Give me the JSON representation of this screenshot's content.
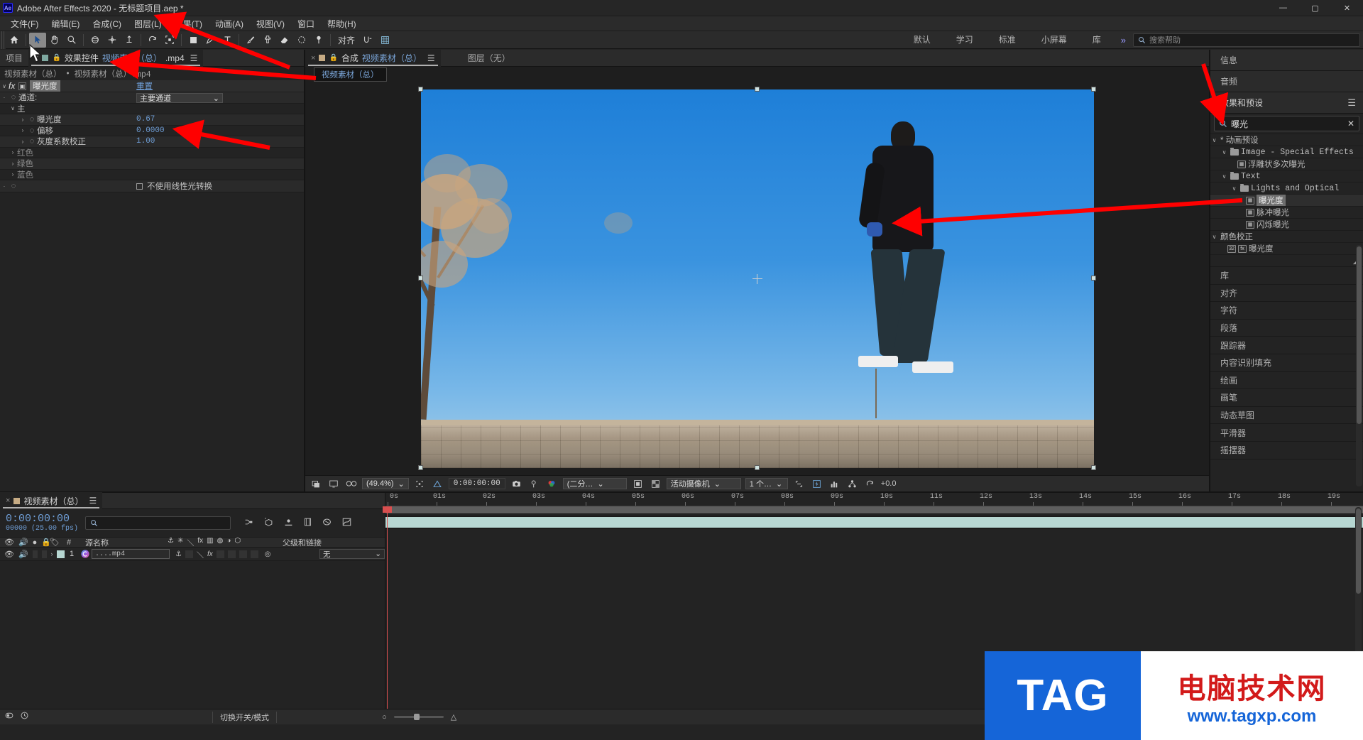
{
  "window": {
    "title": "Adobe After Effects 2020 - 无标题项目.aep *",
    "logo": "Ae",
    "minimize": "—",
    "maximize": "▢",
    "close": "✕"
  },
  "menu": {
    "items": [
      "文件(F)",
      "编辑(E)",
      "合成(C)",
      "图层(L)",
      "效果(T)",
      "动画(A)",
      "视图(V)",
      "窗口",
      "帮助(H)"
    ]
  },
  "toolbar": {
    "align_label": "对齐",
    "workspaces": [
      "默认",
      "学习",
      "标准",
      "小屏幕",
      "库"
    ],
    "more": "»",
    "help_placeholder": "搜索帮助"
  },
  "effect_controls": {
    "tab_project": "项目",
    "tab_close": "×",
    "tab_title": "效果控件",
    "tab_comp": "视频素材（总）",
    "tab_ext": ".mp4",
    "menu_icon": "☰",
    "breadcrumb_comp": "视频素材（总）",
    "breadcrumb_sep": "•",
    "breadcrumb_layer": "视频素材（总）.mp4",
    "effect_name": "曝光度",
    "reset_label": "重置",
    "fx_label": "fx",
    "rows": [
      {
        "indent": 1,
        "label": "通道:",
        "type": "dropdown",
        "value": "主要通道"
      },
      {
        "indent": 1,
        "label": "主",
        "type": "group"
      },
      {
        "indent": 2,
        "label": "曝光度",
        "type": "value",
        "value": "0.67"
      },
      {
        "indent": 2,
        "label": "偏移",
        "type": "value",
        "value": "0.0000"
      },
      {
        "indent": 2,
        "label": "灰度系数校正",
        "type": "value",
        "value": "1.00"
      },
      {
        "indent": 1,
        "label": "红色",
        "type": "group-dim"
      },
      {
        "indent": 1,
        "label": "绿色",
        "type": "group-dim"
      },
      {
        "indent": 1,
        "label": "蓝色",
        "type": "group-dim"
      }
    ],
    "checkbox_label": "不使用线性光转换",
    "checkbox_checked": false
  },
  "composition": {
    "tab_close": "×",
    "tab_lock": "🔒",
    "tab_title": "合成",
    "tab_name": "视频素材（总）",
    "menu_icon": "☰",
    "tab_layer": "图层（无）",
    "chip_name": "视频素材（总）",
    "viewbar": {
      "zoom": "(49.4%)",
      "timecode": "0:00:00:00",
      "resolution": "(二分…",
      "camera": "活动摄像机",
      "views": "1 个…",
      "exposure": "+0.0"
    }
  },
  "right_dock": {
    "tabs": [
      "信息",
      "音频"
    ],
    "effects_title": "效果和预设",
    "menu_icon": "☰",
    "search_value": "曝光",
    "search_clear": "✕",
    "tree": [
      {
        "depth": 0,
        "label": "* 动画预设",
        "kind": "group",
        "expanded": true
      },
      {
        "depth": 1,
        "label": "Image - Special Effects",
        "kind": "folder",
        "expanded": true,
        "mono": true
      },
      {
        "depth": 2,
        "label": "浮雕状多次曝光",
        "kind": "preset"
      },
      {
        "depth": 1,
        "label": "Text",
        "kind": "folder",
        "expanded": true,
        "mono": true
      },
      {
        "depth": 2,
        "label": "Lights and Optical",
        "kind": "folder",
        "expanded": true,
        "mono": true
      },
      {
        "depth": 3,
        "label": "曝光度",
        "kind": "preset",
        "selected": true
      },
      {
        "depth": 3,
        "label": "脉冲曝光",
        "kind": "preset"
      },
      {
        "depth": 3,
        "label": "闪烁曝光",
        "kind": "preset"
      },
      {
        "depth": 0,
        "label": "颜色校正",
        "kind": "group",
        "expanded": true
      },
      {
        "depth": 1,
        "label": "曝光度",
        "kind": "effect"
      }
    ],
    "panels": [
      "库",
      "对齐",
      "字符",
      "段落",
      "跟踪器",
      "内容识别填充",
      "绘画",
      "画笔",
      "动态草图",
      "平滑器",
      "摇摆器"
    ]
  },
  "timeline": {
    "tab_close": "×",
    "tab_name": "视频素材（总）",
    "menu_icon": "☰",
    "current_time": "0:00:00:00",
    "frame_info": "00000 (25.00 fps)",
    "search_placeholder": "",
    "columns": [
      "#",
      "源名称",
      "父级和链接"
    ],
    "layer": {
      "index": "1",
      "source_name": "....mp4",
      "parent": "无",
      "fx_badge": "fx"
    },
    "ruler_ticks": [
      "0s",
      "01s",
      "02s",
      "03s",
      "04s",
      "05s",
      "06s",
      "07s",
      "08s",
      "09s",
      "10s",
      "11s",
      "12s",
      "13s",
      "14s",
      "15s",
      "16s",
      "17s",
      "18s",
      "19s"
    ],
    "footer_switches": "切换开关/模式"
  },
  "watermark": {
    "tag": "TAG",
    "chinese": "电脑技术网",
    "url": "www.tagxp.com"
  },
  "colors": {
    "accent_blue": "#6f9ed6",
    "arrow_red": "#ff0000",
    "selection": "#6e6e6e",
    "panel_bg": "#232323"
  }
}
